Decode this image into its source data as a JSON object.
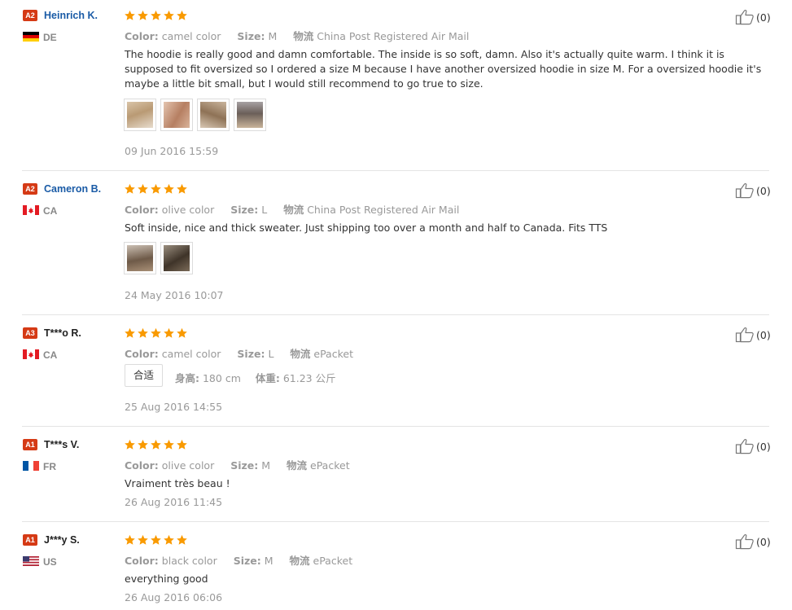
{
  "colors": {
    "star": "#f99a00",
    "badge": "#d53a15",
    "link": "#1a5ba6",
    "muted": "#999999"
  },
  "labels": {
    "color": "Color:",
    "size": "Size:",
    "shipping": "物流",
    "height": "身高:",
    "weight": "体重:"
  },
  "reviews": [
    {
      "level": "A2",
      "name": "Heinrich K.",
      "country": "DE",
      "rating": 5,
      "color": "camel color",
      "size": "M",
      "shipping": "China Post Registered Air Mail",
      "text": "The hoodie is really good and damn comfortable. The inside is so soft, damn. Also it's actually quite warm. I think it is supposed to fit oversized so I ordered a size M because I have another oversized hoodie in size M. For a oversized hoodie it's maybe a little bit small, but I would still recommend to go true to size.",
      "date": "09 Jun 2016 15:59",
      "helpful": "(0)",
      "photo_count": 4
    },
    {
      "level": "A2",
      "name": "Cameron B.",
      "country": "CA",
      "rating": 5,
      "color": "olive color",
      "size": "L",
      "shipping": "China Post Registered Air Mail",
      "text": "Soft inside, nice and thick sweater. Just shipping too over a month and half to Canada. Fits TTS",
      "date": "24 May 2016 10:07",
      "helpful": "(0)",
      "photo_count": 2
    },
    {
      "level": "A3",
      "name": "T***o R.",
      "country": "CA",
      "rating": 5,
      "color": "camel color",
      "size": "L",
      "shipping": "ePacket",
      "fit": "合适",
      "height": "180 cm",
      "weight": "61.23 公斤",
      "date": "25 Aug 2016 14:55",
      "helpful": "(0)"
    },
    {
      "level": "A1",
      "name": "T***s V.",
      "country": "FR",
      "rating": 5,
      "color": "olive color",
      "size": "M",
      "shipping": "ePacket",
      "text": "Vraiment très beau !",
      "date": "26 Aug 2016 11:45",
      "helpful": "(0)"
    },
    {
      "level": "A1",
      "name": "J***y S.",
      "country": "US",
      "rating": 5,
      "color": "black color",
      "size": "M",
      "shipping": "ePacket",
      "text": "everything good",
      "date": "26 Aug 2016 06:06",
      "helpful": "(0)"
    }
  ]
}
